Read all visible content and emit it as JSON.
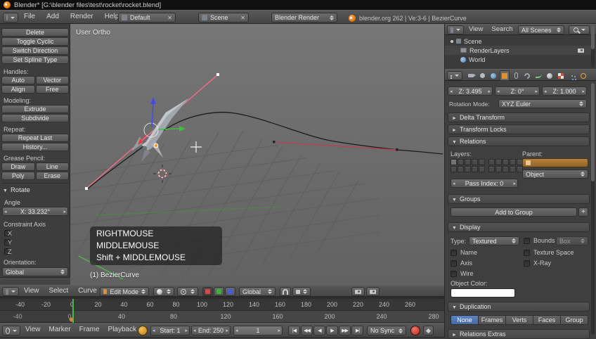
{
  "window": {
    "title": "Blender* [G:\\blender files\\test\\rocket\\rocket.blend]"
  },
  "infobar": {
    "menus": [
      "File",
      "Add",
      "Render",
      "Help"
    ],
    "layout": "Default",
    "scene": "Scene",
    "engine": "Blender Render",
    "status": "blender.org 262 | Ve:3-6 | BezierCurve"
  },
  "toolshelf": {
    "edit_buttons": [
      "Delete",
      "Toggle Cyclic",
      "Switch Direction",
      "Set Spline Type"
    ],
    "handles_label": "Handles:",
    "handles_row1": [
      "Auto",
      "Vector"
    ],
    "handles_row2": [
      "Align",
      "Free"
    ],
    "modeling_label": "Modeling:",
    "modeling_buttons": [
      "Extrude",
      "Subdivide"
    ],
    "repeat_label": "Repeat:",
    "repeat_buttons": [
      "Repeat Last",
      "History..."
    ],
    "grease_label": "Grease Pencil:",
    "grease_row1": [
      "Draw",
      "Line"
    ],
    "grease_row2": [
      "Poly",
      "Erase"
    ],
    "rotate_panel_title": "Rotate",
    "angle_label": "Angle",
    "angle_value": "X: 33.232°",
    "constraint_label": "Constraint Axis",
    "axis_checks": [
      "X",
      "Y",
      "Z"
    ],
    "orientation_label": "Orientation:",
    "orientation_value": "Global"
  },
  "viewport": {
    "view_label": "User Ortho",
    "screencast_keys": [
      "RIGHTMOUSE",
      "MIDDLEMOUSE",
      "Shift + MIDDLEMOUSE"
    ],
    "active_object": "(1) BezierCurve",
    "header": {
      "menus": [
        "View",
        "Select",
        "Curve"
      ],
      "mode": "Edit Mode",
      "orientation": "Global"
    }
  },
  "timeline": {
    "ruler_top": [
      "-40",
      "-20",
      "0",
      "20",
      "40",
      "60",
      "80",
      "100",
      "120",
      "140",
      "160",
      "180",
      "200",
      "220",
      "240",
      "260"
    ],
    "ruler_bottom": [
      "-40",
      "0",
      "40",
      "80",
      "120",
      "160",
      "200",
      "240",
      "280"
    ],
    "menus": [
      "View",
      "Marker",
      "Frame",
      "Playback"
    ],
    "start": "Start: 1",
    "end": "End: 250",
    "frame": "1",
    "sync": "No Sync",
    "playback_buttons": [
      "|◀",
      "◀◀",
      "◀",
      "▶",
      "▶▶",
      "▶|"
    ]
  },
  "outliner": {
    "menus": [
      "View",
      "Search"
    ],
    "scope": "All Scenes",
    "items": [
      {
        "label": "Scene"
      },
      {
        "label": "RenderLayers"
      },
      {
        "label": "World"
      }
    ]
  },
  "properties": {
    "transform": {
      "loc_z": "Z: 3.495",
      "rot_z": "Z: 0°",
      "scale_z": "Z: 1.000"
    },
    "rotation_mode_label": "Rotation Mode:",
    "rotation_mode": "XYZ Euler",
    "panel_delta": "Delta Transform",
    "panel_locks": "Transform Locks",
    "panel_relations": "Relations",
    "layers_label": "Layers:",
    "parent_label": "Parent:",
    "parent_type": "Object",
    "pass_index": "Pass Index: 0",
    "panel_groups": "Groups",
    "add_to_group": "Add to Group",
    "panel_display": "Display",
    "type_label": "Type:",
    "type_value": "Textured",
    "bounds_label": "Bounds",
    "bounds_value": "Box",
    "check_name": "Name",
    "check_texture_space": "Texture Space",
    "check_axis": "Axis",
    "check_xray": "X-Ray",
    "check_wire": "Wire",
    "object_color_label": "Object Color:",
    "object_color": "#ffffff",
    "panel_duplication": "Duplication",
    "duplication_options": [
      "None",
      "Frames",
      "Verts",
      "Faces",
      "Group"
    ],
    "duplication_active": "None",
    "panel_relations_extras": "Relations Extras",
    "layers_block1": [
      true,
      false,
      false,
      false,
      false,
      false,
      false,
      false,
      false,
      false
    ],
    "layers_block2": [
      false,
      false,
      false,
      false,
      false,
      false,
      false,
      false,
      false,
      false
    ]
  },
  "colors": {
    "accent_blue": "#4f74ae",
    "parent_field_orange": "#a8702c",
    "playhead_green": "#49b649"
  }
}
